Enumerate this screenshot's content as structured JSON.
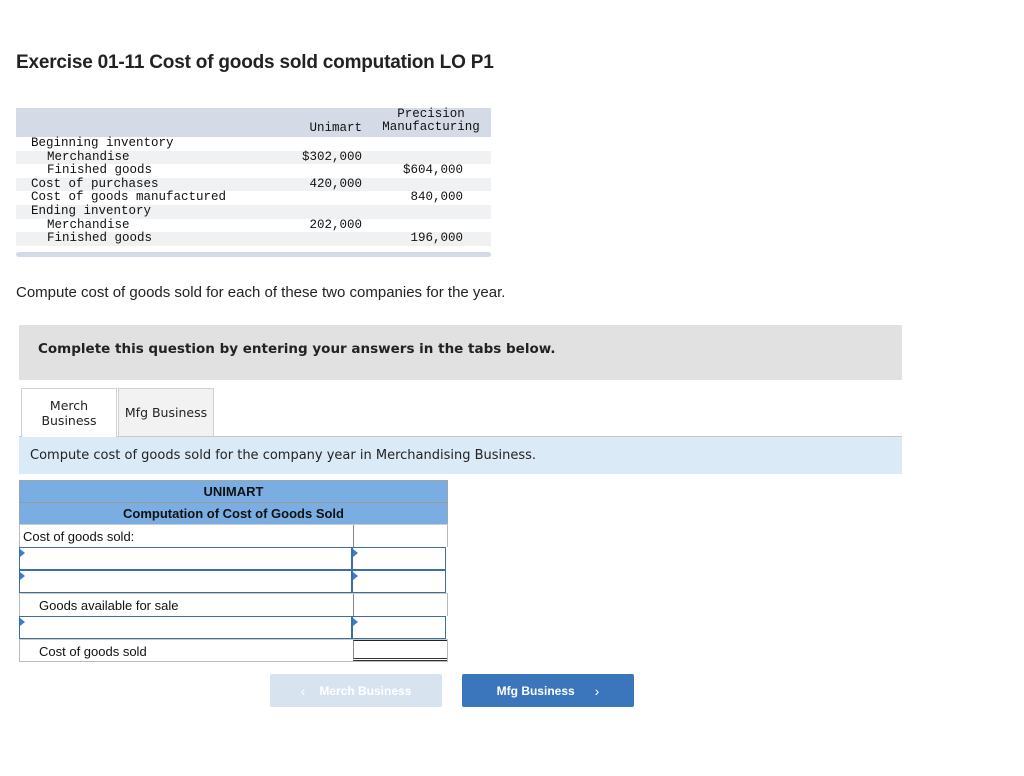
{
  "title": "Exercise 01-11 Cost of goods sold computation LO P1",
  "given": {
    "col1": "Unimart",
    "col2_line1": "Precision",
    "col2_line2": "Manufacturing",
    "rows": [
      {
        "label": "Beginning inventory",
        "unimart": "",
        "precision": "",
        "indent": false
      },
      {
        "label": "Merchandise",
        "unimart": "$302,000",
        "precision": "",
        "indent": true
      },
      {
        "label": "Finished goods",
        "unimart": "",
        "precision": "$604,000",
        "indent": true
      },
      {
        "label": "Cost of purchases",
        "unimart": "420,000",
        "precision": "",
        "indent": false
      },
      {
        "label": "Cost of goods manufactured",
        "unimart": "",
        "precision": "840,000",
        "indent": false
      },
      {
        "label": "Ending inventory",
        "unimart": "",
        "precision": "",
        "indent": false
      },
      {
        "label": "Merchandise",
        "unimart": "202,000",
        "precision": "",
        "indent": true
      },
      {
        "label": "Finished goods",
        "unimart": "",
        "precision": "196,000",
        "indent": true
      }
    ]
  },
  "prompt": "Compute cost of goods sold for each of these two companies for the year.",
  "instruction": "Complete this question by entering your answers in the tabs below.",
  "tabs": [
    {
      "label_line1": "Merch",
      "label_line2": "Business",
      "active": true
    },
    {
      "label": "Mfg Business",
      "active": false
    }
  ],
  "tab_description": "Compute cost of goods sold for the company year in Merchandising Business.",
  "worksheet": {
    "company": "UNIMART",
    "heading": "Computation of Cost of Goods Sold",
    "rows": {
      "cogs_header": "Cost of goods sold:",
      "input1_label": "",
      "input1_value": "",
      "input2_label": "",
      "input2_value": "",
      "goods_available": "Goods available for sale",
      "goods_available_value": "",
      "input3_label": "",
      "input3_value": "",
      "cogs_total": "Cost of goods sold",
      "cogs_total_value": ""
    }
  },
  "nav": {
    "prev_label": "Merch Business",
    "next_label": "Mfg Business",
    "prev_icon": "‹",
    "next_icon": "›"
  }
}
